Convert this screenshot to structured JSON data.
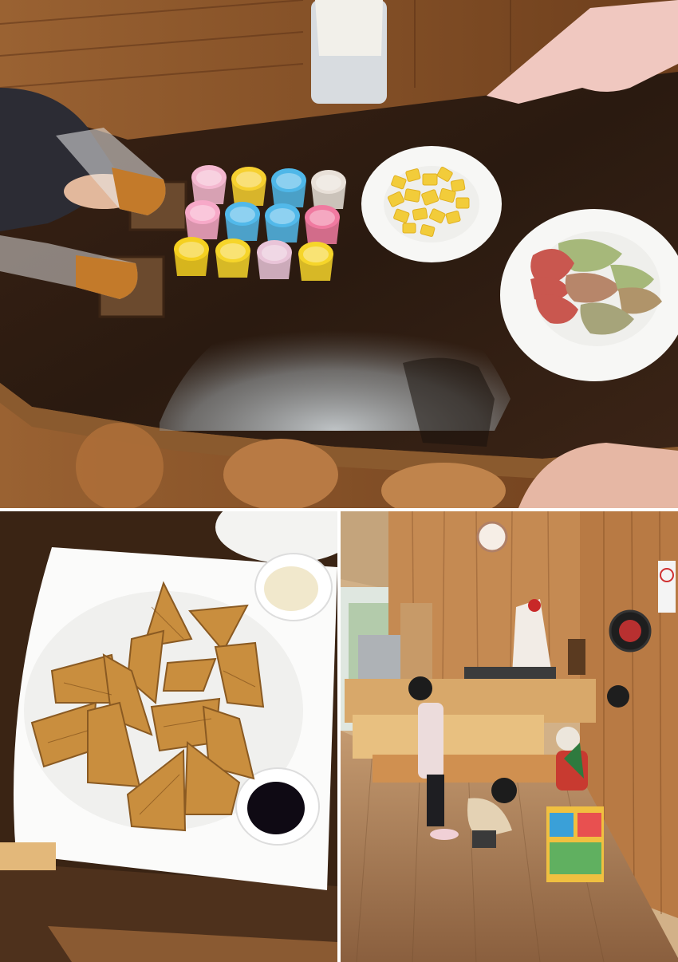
{
  "collage": {
    "panels": [
      {
        "id": "top",
        "subject": "table-with-cups-juice-fruit"
      },
      {
        "id": "bottom-left",
        "subject": "waffles-with-dips"
      },
      {
        "id": "bottom-right",
        "subject": "lobby-children-playing"
      }
    ],
    "colors": {
      "wood_dark": "#4a2a14",
      "wood_mid": "#8a5a32",
      "wood_light": "#c58a52",
      "glass_tint": "#2a1a10",
      "plate": "#f7f7f5",
      "pineapple": "#f2cc3a",
      "wax_apple_red": "#c9574f",
      "wax_apple_green": "#a6b87a",
      "juice": "#c37a2a",
      "waffle": "#c98e3e",
      "floor": "#a57b55",
      "counter": "#e0b070"
    },
    "cups": [
      {
        "color": "#f4b8d0"
      },
      {
        "color": "#f6d030"
      },
      {
        "color": "#4fb7e8"
      },
      {
        "color": "#e8e0d8"
      },
      {
        "color": "#f7a9c8"
      },
      {
        "color": "#52b9ea"
      },
      {
        "color": "#52b9ea"
      },
      {
        "color": "#f07aa0"
      },
      {
        "color": "#f5d020"
      },
      {
        "color": "#f6d52a"
      },
      {
        "color": "#e9c4d8"
      },
      {
        "color": "#f6d52a"
      }
    ]
  }
}
